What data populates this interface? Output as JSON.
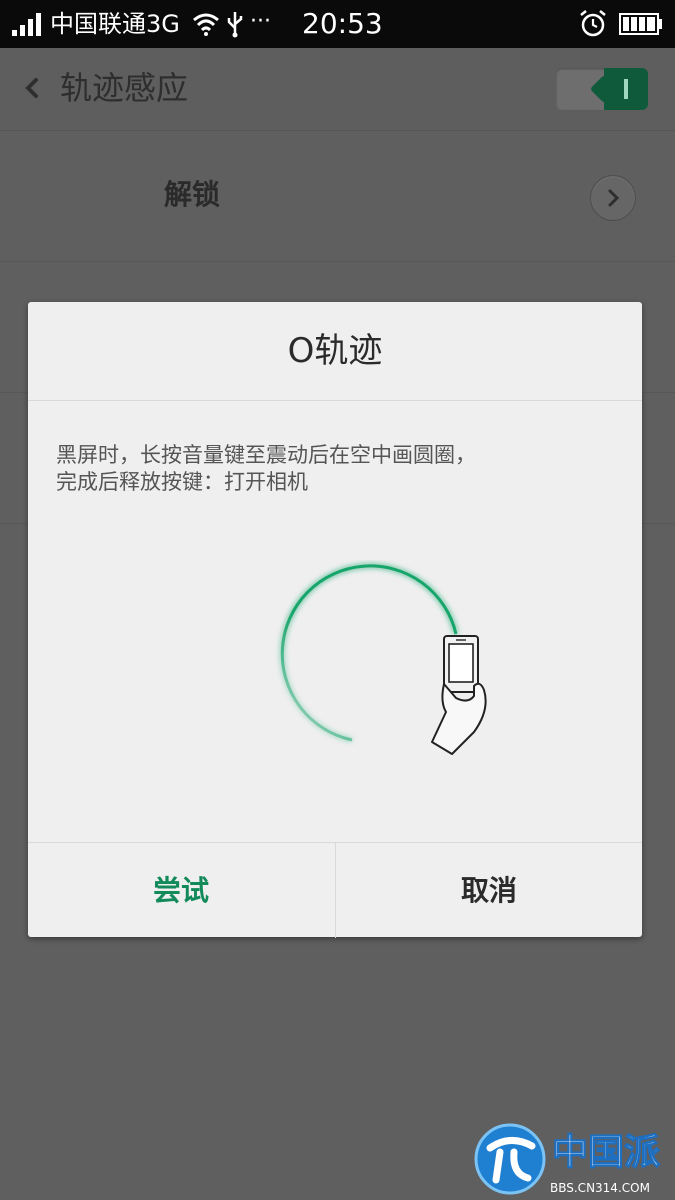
{
  "status_bar": {
    "carrier": "中国联通3G",
    "time": "20:53",
    "more": "···",
    "icons": [
      "signal-icon",
      "wifi-icon",
      "usb-icon",
      "alarm-icon",
      "battery-icon"
    ]
  },
  "header": {
    "back_icon": "back-chevron-icon",
    "title": "轨迹感应",
    "toggle_on": true,
    "toggle_color": "#0f5a3a"
  },
  "list": {
    "items": [
      {
        "label": "解锁",
        "icon": "chevron-right-icon"
      }
    ]
  },
  "dialog": {
    "title": "O轨迹",
    "description_line1": "黑屏时，长按音量键至震动后在空中画圆圈，",
    "description_line2": "完成后释放按键：打开相机",
    "illustration": "circle-gesture-phone-hand-icon",
    "try_label": "尝试",
    "cancel_label": "取消",
    "accent_color": "#138a59"
  },
  "watermark": {
    "brand": "中国派",
    "site": "BBS.CN314.COM"
  }
}
